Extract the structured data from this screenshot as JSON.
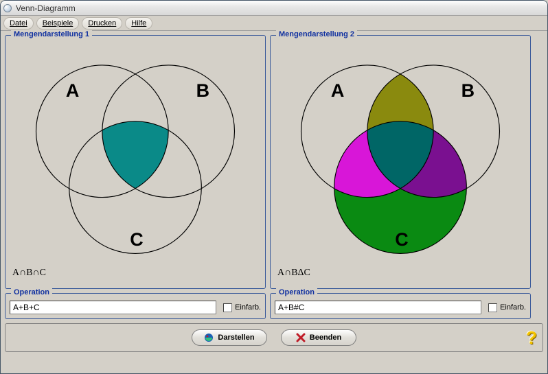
{
  "window": {
    "title": "Venn-Diagramm"
  },
  "menu": {
    "file": "Datei",
    "examples": "Beispiele",
    "print": "Drucken",
    "help": "Hilfe"
  },
  "panels": {
    "left": {
      "title": "Mengendarstellung 1",
      "labelA": "A",
      "labelB": "B",
      "labelC": "C",
      "formula": "A∩B∩C"
    },
    "right": {
      "title": "Mengendarstellung 2",
      "labelA": "A",
      "labelB": "B",
      "labelC": "C",
      "formula": "A∩BΔC"
    }
  },
  "operations": {
    "legend": "Operation",
    "left": {
      "value": "A+B+C",
      "monochrome_label": "Einfarb."
    },
    "right": {
      "value": "A+B#C",
      "monochrome_label": "Einfarb."
    }
  },
  "buttons": {
    "render": "Darstellen",
    "close": "Beenden"
  },
  "colors": {
    "center_left": "#0a8a88",
    "ab_only": "#8a8a0e",
    "ac_only": "#d816d8",
    "bc_only": "#7a1090",
    "c_fill": "#0a8a12",
    "abc_right": "#006666"
  },
  "chart_data": [
    {
      "type": "venn3",
      "title": "Mengendarstellung 1",
      "sets": [
        "A",
        "B",
        "C"
      ],
      "expression": "A∩B∩C",
      "regions": {
        "A_only": {
          "shaded": false
        },
        "B_only": {
          "shaded": false
        },
        "C_only": {
          "shaded": false
        },
        "AB_only": {
          "shaded": false
        },
        "AC_only": {
          "shaded": false
        },
        "BC_only": {
          "shaded": false
        },
        "ABC": {
          "shaded": true,
          "color": "#0a8a88"
        }
      }
    },
    {
      "type": "venn3",
      "title": "Mengendarstellung 2",
      "sets": [
        "A",
        "B",
        "C"
      ],
      "expression": "A∩BΔC",
      "regions": {
        "A_only": {
          "shaded": false
        },
        "B_only": {
          "shaded": false
        },
        "C_only": {
          "shaded": true,
          "color": "#0a8a12"
        },
        "AB_only": {
          "shaded": true,
          "color": "#8a8a0e"
        },
        "AC_only": {
          "shaded": true,
          "color": "#d816d8"
        },
        "BC_only": {
          "shaded": true,
          "color": "#7a1090"
        },
        "ABC": {
          "shaded": true,
          "color": "#006666"
        }
      }
    }
  ]
}
